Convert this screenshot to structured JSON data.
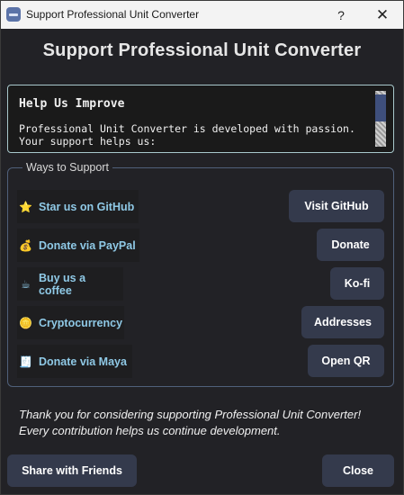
{
  "window": {
    "title": "Support Professional Unit Converter",
    "help_glyph": "?",
    "close_glyph": "✕"
  },
  "header": {
    "title": "Support Professional Unit Converter"
  },
  "info": {
    "heading": "Help Us Improve",
    "line1": "Professional Unit Converter is developed with passion.",
    "line2": "Your support helps us:"
  },
  "ways": {
    "group_title": "Ways to Support",
    "items": [
      {
        "icon": "⭐",
        "icon_name": "star-icon",
        "label": "Star us on GitHub",
        "button": "Visit GitHub"
      },
      {
        "icon": "💰",
        "icon_name": "money-bag-icon",
        "label": "Donate via PayPal",
        "button": "Donate"
      },
      {
        "icon": "☕",
        "icon_name": "coffee-icon",
        "label": "Buy us a coffee",
        "button": "Ko-fi"
      },
      {
        "icon": "🪙",
        "icon_name": "coin-icon",
        "label": "Cryptocurrency",
        "button": "Addresses"
      },
      {
        "icon": "🧾",
        "icon_name": "receipt-icon",
        "label": "Donate via Maya",
        "button": "Open QR"
      }
    ]
  },
  "footer": {
    "thanks_line1": "Thank you for considering supporting Professional Unit Converter!",
    "thanks_line2": "Every contribution helps us continue development.",
    "share_label": "Share with Friends",
    "close_label": "Close"
  },
  "colors": {
    "background": "#222226",
    "button": "#343a4c",
    "link_text": "#8fc9e6",
    "info_border": "#a8c8cc",
    "group_border": "#50607a"
  }
}
